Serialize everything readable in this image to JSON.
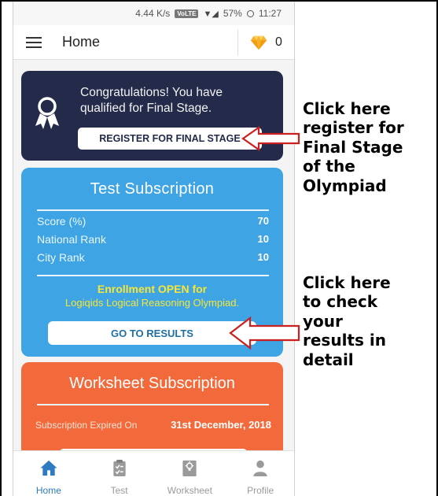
{
  "status_bar": {
    "speed": "4.44 K/s",
    "network_badge": "VoLTE",
    "battery": "57%",
    "time": "11:27"
  },
  "app_bar": {
    "title": "Home",
    "gem_count": "0",
    "menu_icon": "hamburger-icon",
    "gem_icon": "diamond-icon"
  },
  "final_stage_card": {
    "message": "Congratulations! You have qualified for Final Stage.",
    "register_label": "REGISTER FOR FINAL STAGE",
    "icon": "medal-icon",
    "color": "#232a4a"
  },
  "test_card": {
    "title": "Test Subscription",
    "color": "#3ea4e3",
    "stats": [
      {
        "label": "Score (%)",
        "value": "70"
      },
      {
        "label": "National Rank",
        "value": "10"
      },
      {
        "label": "City Rank",
        "value": "10"
      }
    ],
    "enroll_title": "Enrollment OPEN for",
    "enroll_sub": "Logiqids Logical Reasoning Olympiad.",
    "results_label": "GO TO RESULTS"
  },
  "worksheet_card": {
    "title": "Worksheet Subscription",
    "color": "#f26a3b",
    "expiry_label": "Subscription Expired On",
    "expiry_value": "31st December, 2018"
  },
  "bottom_nav": {
    "items": [
      {
        "label": "Home",
        "icon": "home-icon",
        "active": true
      },
      {
        "label": "Test",
        "icon": "clipboard-icon",
        "active": false
      },
      {
        "label": "Worksheet",
        "icon": "worksheet-icon",
        "active": false
      },
      {
        "label": "Profile",
        "icon": "profile-icon",
        "active": false
      }
    ],
    "active_color": "#2e7bbf"
  },
  "annotations": {
    "register_note": [
      "Click here",
      "register for",
      "Final Stage",
      "of the",
      "Olympiad"
    ],
    "results_note": [
      "Click here",
      "to check",
      "your",
      "results in",
      "detail"
    ],
    "arrow_color": "#cc1f1f"
  }
}
